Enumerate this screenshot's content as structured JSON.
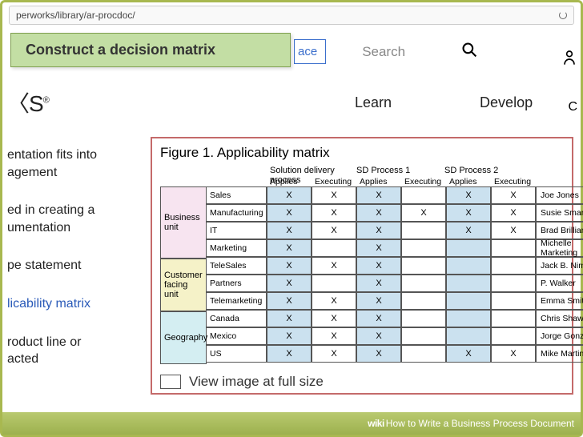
{
  "url": "perworks/library/ar-procdoc/",
  "callout": "Construct a decision matrix",
  "marketplace_btn": "ace",
  "search_placeholder": "Search",
  "brand_fragment": "〈S",
  "brand_reg": "®",
  "nav": {
    "learn": "Learn",
    "develop": "Develop",
    "last": "C"
  },
  "left_text": {
    "l1a": "entation fits into",
    "l1b": "agement",
    "l2a": "ed in creating a",
    "l2b": "umentation",
    "l3": "pe statement",
    "l4": "licability matrix",
    "l5a": "roduct line or",
    "l5b": "acted"
  },
  "figure": {
    "title": "Figure 1. Applicability matrix",
    "view_full": "View image at full size",
    "groups": [
      {
        "key": "bu",
        "label": "Business unit"
      },
      {
        "key": "cf",
        "label": "Customer facing unit"
      },
      {
        "key": "geo",
        "label": "Geography"
      }
    ],
    "processes": [
      "Solution delivery process",
      "SD Process 1",
      "SD Process 2"
    ],
    "subcols": [
      "Applies",
      "Executing"
    ],
    "rows": [
      {
        "label": "Sales",
        "cells": [
          "X",
          "X",
          "X",
          "",
          "X",
          "X"
        ],
        "person": "Joe Jones"
      },
      {
        "label": "Manufacturing",
        "cells": [
          "X",
          "X",
          "X",
          "X",
          "X",
          "X"
        ],
        "person": "Susie Smart"
      },
      {
        "label": "IT",
        "cells": [
          "X",
          "X",
          "X",
          "",
          "X",
          "X"
        ],
        "person": "Brad Brilliant"
      },
      {
        "label": "Marketing",
        "cells": [
          "X",
          "",
          "X",
          "",
          "",
          ""
        ],
        "person": "Michelle Marketing"
      },
      {
        "label": "TeleSales",
        "cells": [
          "X",
          "X",
          "X",
          "",
          "",
          ""
        ],
        "person": "Jack B. Nimble"
      },
      {
        "label": "Partners",
        "cells": [
          "X",
          "",
          "X",
          "",
          "",
          ""
        ],
        "person": "P. Walker"
      },
      {
        "label": "Telemarketing",
        "cells": [
          "X",
          "X",
          "X",
          "",
          "",
          ""
        ],
        "person": "Emma Smith"
      },
      {
        "label": "Canada",
        "cells": [
          "X",
          "X",
          "X",
          "",
          "",
          ""
        ],
        "person": "Chris Shaw"
      },
      {
        "label": "Mexico",
        "cells": [
          "X",
          "X",
          "X",
          "",
          "",
          ""
        ],
        "person": "Jorge Gonzales"
      },
      {
        "label": "US",
        "cells": [
          "X",
          "X",
          "X",
          "",
          "X",
          "X"
        ],
        "person": "Mike Martin"
      }
    ]
  },
  "footer": {
    "wiki": "wiki",
    "how": "How to Write a Business Process Document"
  }
}
